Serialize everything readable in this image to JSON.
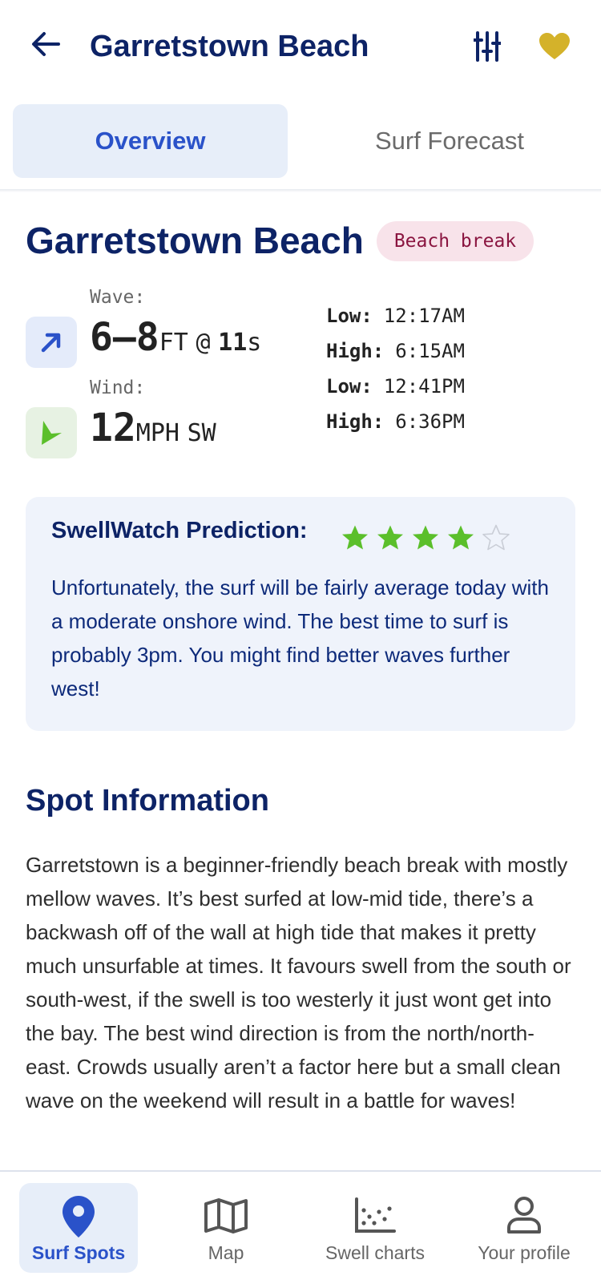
{
  "header": {
    "title": "Garretstown Beach",
    "back_icon": "arrow-left-icon",
    "filter_icon": "sliders-icon",
    "favorite_icon": "heart-icon",
    "favorite_color": "#d4b22a"
  },
  "tabs": [
    {
      "label": "Overview",
      "active": true
    },
    {
      "label": "Surf Forecast",
      "active": false
    }
  ],
  "spot": {
    "name": "Garretstown Beach",
    "break_type": "Beach break"
  },
  "conditions": {
    "wave_label": "Wave:",
    "wave_height": "6–8",
    "wave_unit": "FT",
    "wave_at": "@",
    "wave_period": "11",
    "wave_period_unit": "s",
    "wind_label": "Wind:",
    "wind_speed": "12",
    "wind_unit": "MPH",
    "wind_direction": "SW"
  },
  "tides": [
    {
      "label": "Low:",
      "time": "12:17AM"
    },
    {
      "label": "High:",
      "time": "6:15AM"
    },
    {
      "label": "Low:",
      "time": "12:41PM"
    },
    {
      "label": "High:",
      "time": "6:36PM"
    }
  ],
  "prediction": {
    "title": "SwellWatch Prediction:",
    "rating": 4,
    "max_rating": 5,
    "star_color": "#5bbf2b",
    "text": "Unfortunately, the surf will be fairly average today with a moderate onshore wind. The best time to surf is probably 3pm. You might find better waves further west!"
  },
  "spot_info": {
    "title": "Spot Information",
    "text": "Garretstown is a beginner-friendly beach break with mostly mellow waves. It’s best surfed at low-mid tide, there’s a backwash off of the wall at high tide that makes it pretty much unsurfable at times. It favours swell from the south or south-west, if the swell is too westerly it just wont get into the bay. The best wind direction is from the north/north-east. Crowds usually aren’t a factor here but a small clean wave on the weekend will result in a battle for waves!"
  },
  "bottom_nav": [
    {
      "label": "Surf Spots",
      "icon": "map-pin-icon",
      "active": true
    },
    {
      "label": "Map",
      "icon": "map-icon",
      "active": false
    },
    {
      "label": "Swell charts",
      "icon": "scatter-chart-icon",
      "active": false
    },
    {
      "label": "Your profile",
      "icon": "user-icon",
      "active": false
    }
  ]
}
